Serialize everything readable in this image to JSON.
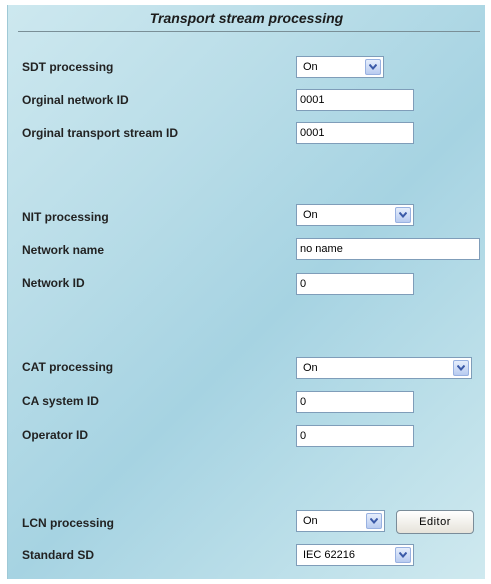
{
  "panel": {
    "title": "Transport stream processing"
  },
  "sdt": {
    "processing_label": "SDT processing",
    "processing_value": "On",
    "network_id_label": "Orginal network ID",
    "network_id_value": "0001",
    "ts_id_label": "Orginal transport stream ID",
    "ts_id_value": "0001"
  },
  "nit": {
    "processing_label": "NIT processing",
    "processing_value": "On",
    "network_name_label": "Network name",
    "network_name_value": "no name",
    "network_id_label": "Network ID",
    "network_id_value": "0"
  },
  "cat": {
    "processing_label": "CAT processing",
    "processing_value": "On",
    "ca_system_id_label": "CA system ID",
    "ca_system_id_value": "0",
    "operator_id_label": "Operator ID",
    "operator_id_value": "0"
  },
  "lcn": {
    "processing_label": "LCN processing",
    "processing_value": "On",
    "editor_button": "Editor",
    "standard_label": "Standard SD",
    "standard_value": "IEC 62216"
  },
  "icons": {
    "dropdown": "chevron-down-icon"
  },
  "colors": {
    "panel_bg": "#b9dde8",
    "field_border": "#7f9db9",
    "arrow_bg": "#c7d7f5"
  }
}
